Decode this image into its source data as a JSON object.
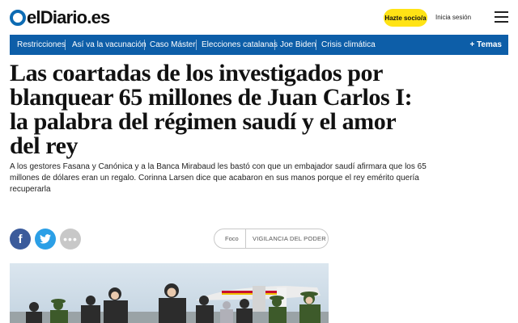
{
  "header": {
    "logo_text": "elDiario.es",
    "subscribe_label": "Hazte socio/a",
    "login_label": "Inicia sesión"
  },
  "nav": {
    "items": [
      {
        "label": "Restricciones"
      },
      {
        "label": "Así va la vacunación"
      },
      {
        "label": "Caso Máster"
      },
      {
        "label": "Elecciones catalanas"
      },
      {
        "label": "Joe Biden"
      },
      {
        "label": "Crisis climática"
      }
    ],
    "temas_label": "+ Temas"
  },
  "article": {
    "headline": "Las coartadas de los investigados por blanquear 65 millones de Juan Carlos I: la palabra del régimen saudí y el amor del rey",
    "lead": "A los gestores Fasana y Canónica y a la Banca Mirabaud les bastó con que un embajador saudí afirmara que los 65 millones de dólares eran un regalo. Corinna Larsen dice que acabaron en sus manos porque el rey emérito quería recuperarla"
  },
  "share": {
    "facebook_glyph": "f",
    "more_glyph": "•••"
  },
  "tag": {
    "label": "Foco",
    "value": "VIGILANCIA DEL PODER"
  },
  "colors": {
    "brand_blue": "#0d5ea8",
    "logo_blue": "#0d6bb3",
    "subscribe_yellow": "#ffe315",
    "facebook": "#3b5b9b",
    "twitter": "#2b9fe6"
  }
}
